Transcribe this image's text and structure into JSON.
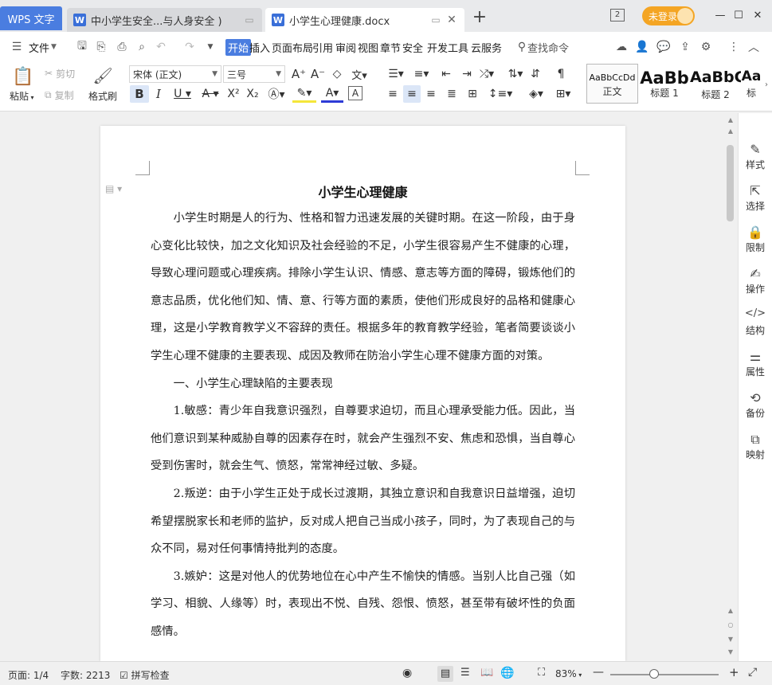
{
  "titlebar": {
    "wps_label": "WPS 文字",
    "tabs": [
      {
        "title": "中小学生安全...与人身安全 )"
      },
      {
        "title": "小学生心理健康.docx"
      }
    ],
    "add_tab": "+",
    "window_count": "2",
    "login_label": "未登录"
  },
  "menu": {
    "file_label": "文件",
    "items": [
      "开始",
      "插入",
      "页面布局",
      "引用",
      "审阅",
      "视图",
      "章节",
      "安全",
      "开发工具",
      "云服务"
    ],
    "active_item": "开始",
    "search_label": "查找命令"
  },
  "ribbon": {
    "paste_label": "粘贴",
    "cut_label": "剪切",
    "copy_label": "复制",
    "format_painter_label": "格式刷",
    "font_name": "宋体 (正文)",
    "font_size": "三号",
    "styles": [
      {
        "sample": "AaBbCcDd",
        "name": "正文"
      },
      {
        "sample": "AaBb",
        "name": "标题 1"
      },
      {
        "sample": "AaBbC",
        "name": "标题 2"
      },
      {
        "sample": "Aa",
        "name": "标"
      }
    ]
  },
  "sidebar": {
    "items": [
      {
        "label": "样式",
        "icon": "pen-icon"
      },
      {
        "label": "选择",
        "icon": "cursor-icon"
      },
      {
        "label": "限制",
        "icon": "lock-icon"
      },
      {
        "label": "操作",
        "icon": "edit-icon"
      },
      {
        "label": "结构",
        "icon": "code-icon"
      },
      {
        "label": "属性",
        "icon": "sliders-icon"
      },
      {
        "label": "备份",
        "icon": "history-icon"
      },
      {
        "label": "映射",
        "icon": "map-icon"
      }
    ]
  },
  "document": {
    "title": "小学生心理健康",
    "paragraphs": [
      "小学生时期是人的行为、性格和智力迅速发展的关键时期。在这一阶段，由于身心变化比较快，加之文化知识及社会经验的不足，小学生很容易产生不健康的心理，导致心理问题或心理疾病。排除小学生认识、情感、意志等方面的障碍，锻炼他们的意志品质，优化他们知、情、意、行等方面的素质，使他们形成良好的品格和健康心理，这是小学教育教学义不容辞的责任。根据多年的教育教学经验，笔者简要谈谈小学生心理不健康的主要表现、成因及教师在防治小学生心理不健康方面的对策。",
      "一、小学生心理缺陷的主要表现",
      "1.敏感：青少年自我意识强烈，自尊要求迫切，而且心理承受能力低。因此，当他们意识到某种威胁自尊的因素存在时，就会产生强烈不安、焦虑和恐惧，当自尊心受到伤害时，就会生气、愤怒，常常神经过敏、多疑。",
      "2.叛逆：由于小学生正处于成长过渡期，其独立意识和自我意识日益增强，迫切希望摆脱家长和老师的监护，反对成人把自己当成小孩子，同时，为了表现自己的与众不同，易对任何事情持批判的态度。",
      "3.嫉妒：这是对他人的优势地位在心中产生不愉快的情感。当别人比自己强（如学习、相貌、人缘等）时，表现出不悦、自残、怨恨、愤怒，甚至带有破坏性的负面感情。"
    ]
  },
  "status": {
    "page": "页面: 1/4",
    "words": "字数: 2213",
    "spell": "拼写检查",
    "zoom": "83%"
  },
  "colors": {
    "accent": "#4a7de0",
    "login": "#f4a524"
  }
}
